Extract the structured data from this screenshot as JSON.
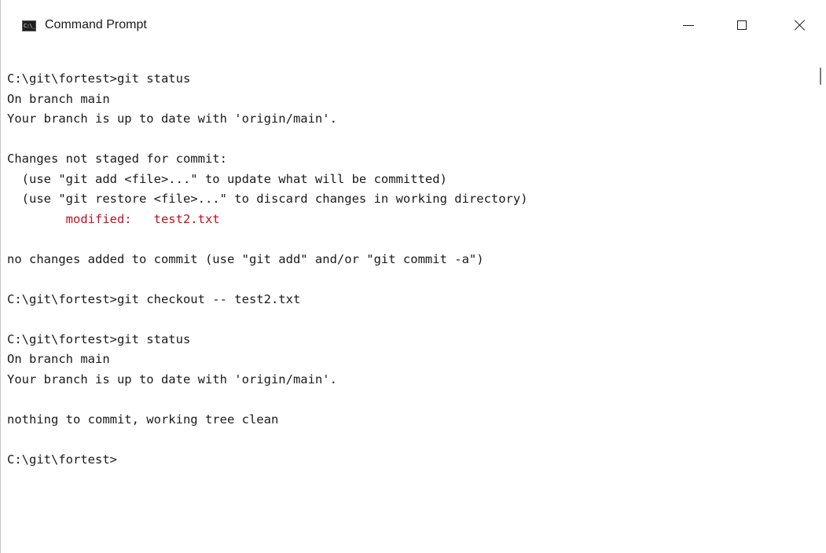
{
  "window": {
    "title": "Command Prompt",
    "icon": "C:\\_"
  },
  "controls": {
    "minimize": "minimize",
    "maximize": "maximize",
    "close": "close"
  },
  "console": {
    "lines": [
      {
        "text": "C:\\git\\fortest>git status"
      },
      {
        "text": "On branch main"
      },
      {
        "text": "Your branch is up to date with 'origin/main'."
      },
      {
        "text": ""
      },
      {
        "text": "Changes not staged for commit:"
      },
      {
        "text": "  (use \"git add <file>...\" to update what will be committed)"
      },
      {
        "text": "  (use \"git restore <file>...\" to discard changes in working directory)"
      },
      {
        "text": "        modified:   test2.txt",
        "color": "#c50f1f"
      },
      {
        "text": ""
      },
      {
        "text": "no changes added to commit (use \"git add\" and/or \"git commit -a\")"
      },
      {
        "text": ""
      },
      {
        "text": "C:\\git\\fortest>git checkout -- test2.txt"
      },
      {
        "text": ""
      },
      {
        "text": "C:\\git\\fortest>git status"
      },
      {
        "text": "On branch main"
      },
      {
        "text": "Your branch is up to date with 'origin/main'."
      },
      {
        "text": ""
      },
      {
        "text": "nothing to commit, working tree clean"
      },
      {
        "text": ""
      },
      {
        "text": "C:\\git\\fortest>"
      }
    ]
  },
  "colors": {
    "text": "#1a1a1a",
    "error_red": "#c50f1f",
    "background": "#ffffff"
  }
}
